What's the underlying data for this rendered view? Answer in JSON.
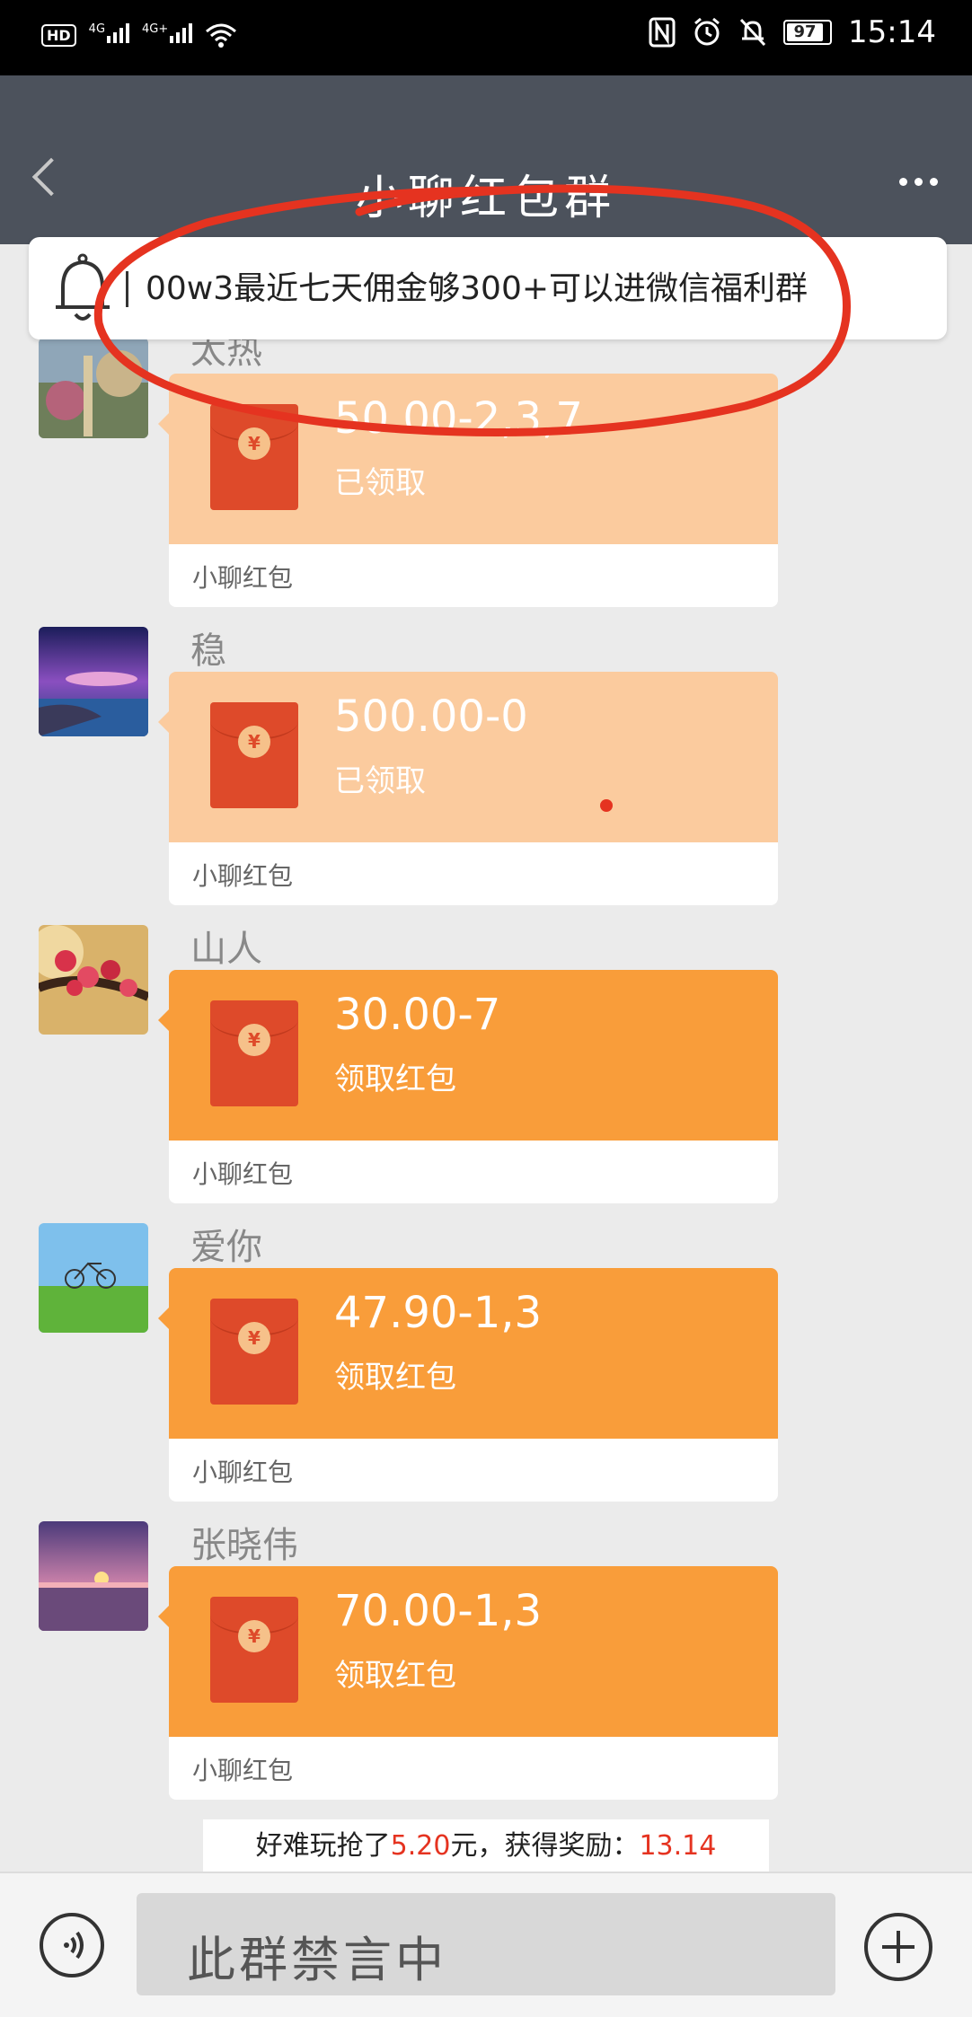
{
  "status_bar": {
    "hd": "HD",
    "sim1": "4G",
    "sim2": "4G+",
    "battery": "97",
    "time": "15:14"
  },
  "header": {
    "title": "小聊红包群"
  },
  "notice": {
    "text": "00w3最近七天佣金够300+可以进微信福利群"
  },
  "messages": [
    {
      "sender": "太热",
      "amount": "50.00-2,3,7",
      "status": "已领取",
      "label": "小聊红包",
      "state": "claimed"
    },
    {
      "sender": "稳",
      "amount": "500.00-0",
      "status": "已领取",
      "label": "小聊红包",
      "state": "claimed"
    },
    {
      "sender": "山人",
      "amount": "30.00-7",
      "status": "领取红包",
      "label": "小聊红包",
      "state": "open"
    },
    {
      "sender": "爱你",
      "amount": "47.90-1,3",
      "status": "领取红包",
      "label": "小聊红包",
      "state": "open"
    },
    {
      "sender": "张晓伟",
      "amount": "70.00-1,3",
      "status": "领取红包",
      "label": "小聊红包",
      "state": "open"
    }
  ],
  "system_message": {
    "prefix": "好难玩抢了",
    "grabbed": "5.20",
    "middle": "元，获得奖励：",
    "reward": "13.14"
  },
  "input_bar": {
    "placeholder": "此群禁言中"
  },
  "colors": {
    "nav": "#4c525c",
    "claimed_bubble": "#fbcb9e",
    "open_bubble": "#f99d3a",
    "annotation": "#e53320"
  }
}
